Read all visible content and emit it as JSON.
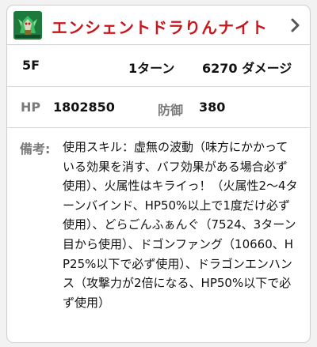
{
  "header": {
    "title": "エンシェントドラりんナイト",
    "icon": "dragon-knight-monster-icon",
    "chevron_icon": "chevron-right-icon",
    "title_color": "#c9161d"
  },
  "turn_row": {
    "floor": "5F",
    "turns": "1ターン",
    "damage": "6270 ダメージ"
  },
  "stats_row": {
    "hp_label": "HP",
    "hp_value": "1802850",
    "defense_label": "防御",
    "defense_value": "380"
  },
  "notes": {
    "label": "備考:",
    "text": "使用スキル：虚無の波動（味方にかかっている効果を消す、バフ効果がある場合必ず使用）、火属性はキライっ！（火属性2〜4ターンバインド、HP50%以上で1度だけ必ず使用）、どらごんふぁんぐ（7524、3ターン目から使用）、ドゴンファング（10660、HP25%以下で必ず使用）、ドラゴンエンハンス（攻撃力が2倍になる、HP50%以下で必ず使用）"
  }
}
